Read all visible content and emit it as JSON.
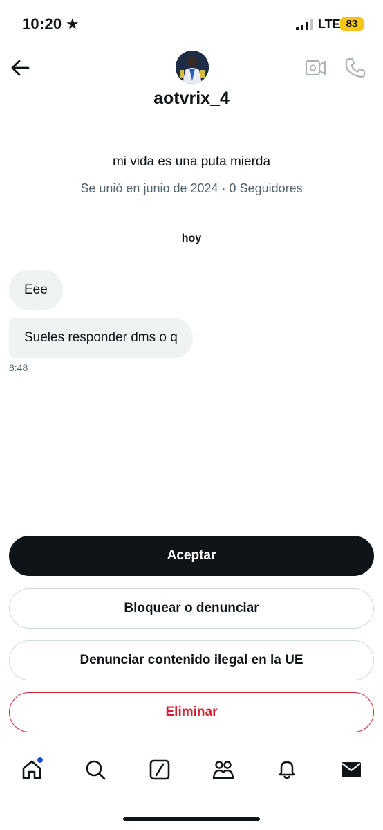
{
  "status_bar": {
    "time": "10:20",
    "network": "LTE",
    "battery": "83"
  },
  "header": {
    "username": "aotvrix_4",
    "icons": [
      "back-arrow-icon",
      "video-call-icon",
      "phone-icon"
    ]
  },
  "profile": {
    "bio": "mi vida es una puta mierda",
    "meta": "Se unió en junio de 2024 · 0 Seguidores"
  },
  "conversation": {
    "date_label": "hoy",
    "messages": [
      {
        "text": "Eee"
      },
      {
        "text": "Sueles responder dms o q"
      }
    ],
    "last_time": "8:48"
  },
  "actions": {
    "accept": "Aceptar",
    "block": "Bloquear o denunciar",
    "report_eu": "Denunciar contenido ilegal en la UE",
    "delete": "Eliminar"
  },
  "bottom_nav": {
    "items": [
      "home-icon",
      "search-icon",
      "grok-icon",
      "communities-icon",
      "notifications-icon",
      "messages-icon"
    ]
  },
  "colors": {
    "accent_dark": "#0f1419",
    "muted": "#536471",
    "danger": "#cc2433",
    "battery": "#f5c518",
    "notification_dot": "#1d4ed8"
  }
}
